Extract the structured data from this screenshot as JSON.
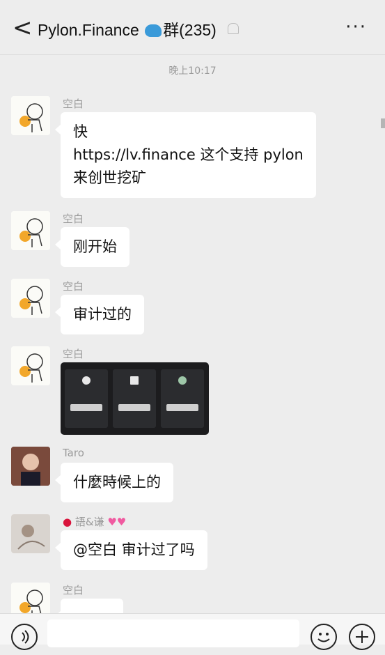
{
  "header": {
    "title": "Pylon.Finance",
    "group_suffix": "群(235)",
    "back_label": "<",
    "more_label": "···"
  },
  "time_divider": "晚上10:17",
  "messages": [
    {
      "sender": "空白",
      "avatar": "sticker-avatar",
      "lines": [
        "快",
        "https://lv.finance  这个支持 pylon",
        "来创世挖矿"
      ]
    },
    {
      "sender": "空白",
      "avatar": "sticker-avatar",
      "lines": [
        "刚开始"
      ]
    },
    {
      "sender": "空白",
      "avatar": "sticker-avatar",
      "lines": [
        "审计过的"
      ]
    },
    {
      "sender": "空白",
      "avatar": "sticker-avatar",
      "image": "screenshot-of-pool-cards"
    },
    {
      "sender": "Taro",
      "avatar": "photo-avatar",
      "lines": [
        "什麼時候上的"
      ]
    },
    {
      "sender": "語&谦",
      "avatar": "photo-avatar",
      "lines": [
        "@空白  审计过了吗"
      ]
    },
    {
      "sender": "空白",
      "avatar": "sticker-avatar",
      "lines": [
        ""
      ]
    }
  ],
  "footer": {
    "voice_icon": "voice-icon",
    "emoji_icon": "emoji-icon",
    "plus_icon": "plus-icon"
  }
}
